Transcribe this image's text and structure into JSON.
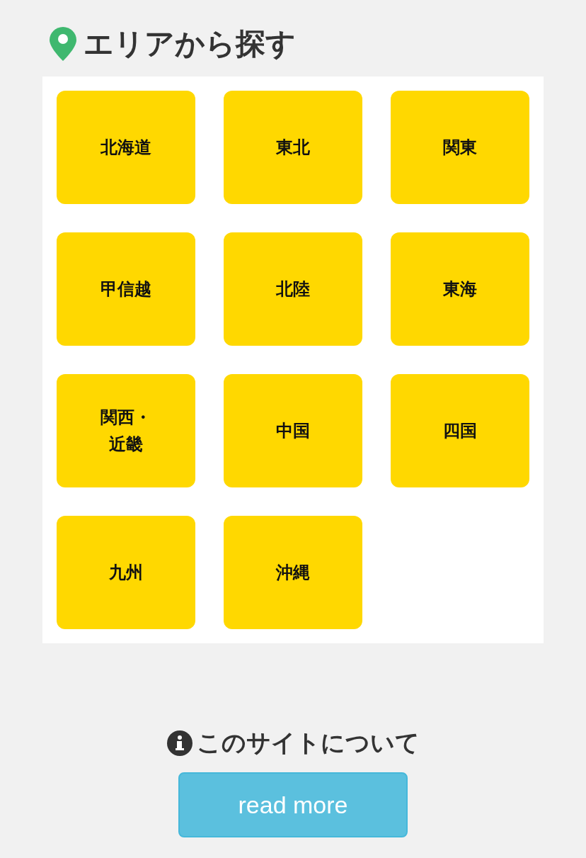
{
  "area_section": {
    "title": "エリアから探す",
    "areas": [
      {
        "label": "北海道"
      },
      {
        "label": "東北"
      },
      {
        "label": "関東"
      },
      {
        "label": "甲信越"
      },
      {
        "label": "北陸"
      },
      {
        "label": "東海"
      },
      {
        "label": "関西・近畿"
      },
      {
        "label": "中国"
      },
      {
        "label": "四国"
      },
      {
        "label": "九州"
      },
      {
        "label": "沖縄"
      }
    ]
  },
  "about_section": {
    "title": "このサイトについて",
    "button": "read more"
  }
}
